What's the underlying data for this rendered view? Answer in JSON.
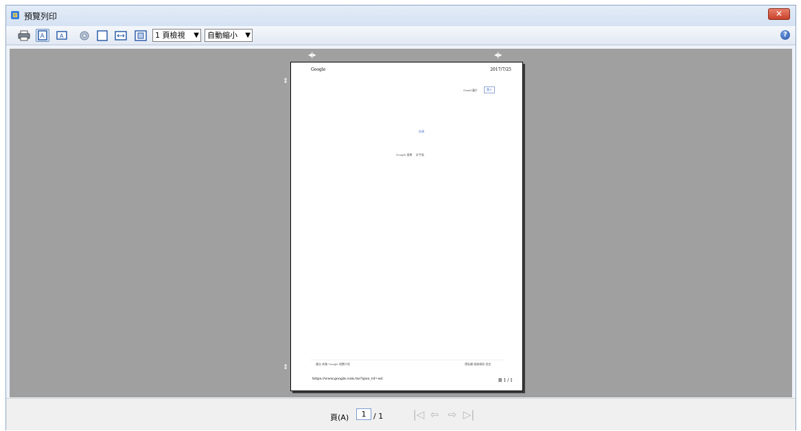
{
  "window": {
    "title": "預覽列印"
  },
  "toolbar": {
    "print_icon": "printer-icon",
    "portrait_icon": "portrait-orientation-icon",
    "landscape_icon": "landscape-orientation-icon",
    "page_setup_icon": "gear-icon",
    "header_footer_icon": "header-footer-icon",
    "full_width_icon": "full-width-icon",
    "full_page_icon": "full-page-icon",
    "view_select": "1 頁檢視",
    "scale_select": "自動縮小",
    "help_icon": "help-icon"
  },
  "page_preview": {
    "header_left": "Google",
    "header_right": "2017/7/25",
    "top_link1": "Gmail",
    "top_link2": "圖片",
    "top_button": "登入",
    "logo_text": "台灣",
    "search_btn1": "Google 搜尋",
    "search_btn2": "好手氣",
    "footer_links_left": "廣告   商業   Google 相關介紹",
    "footer_links_right": "隱私權   服務條款   設定",
    "url": "https://www.google.com.tw/?gws_rd=ssl",
    "page_info": "頁 1 / 1"
  },
  "statusbar": {
    "page_label": "頁(A)",
    "page_value": "1",
    "page_total": "/ 1",
    "first_icon": "first-page-icon",
    "prev_icon": "previous-page-icon",
    "next_icon": "next-page-icon",
    "last_icon": "last-page-icon"
  }
}
